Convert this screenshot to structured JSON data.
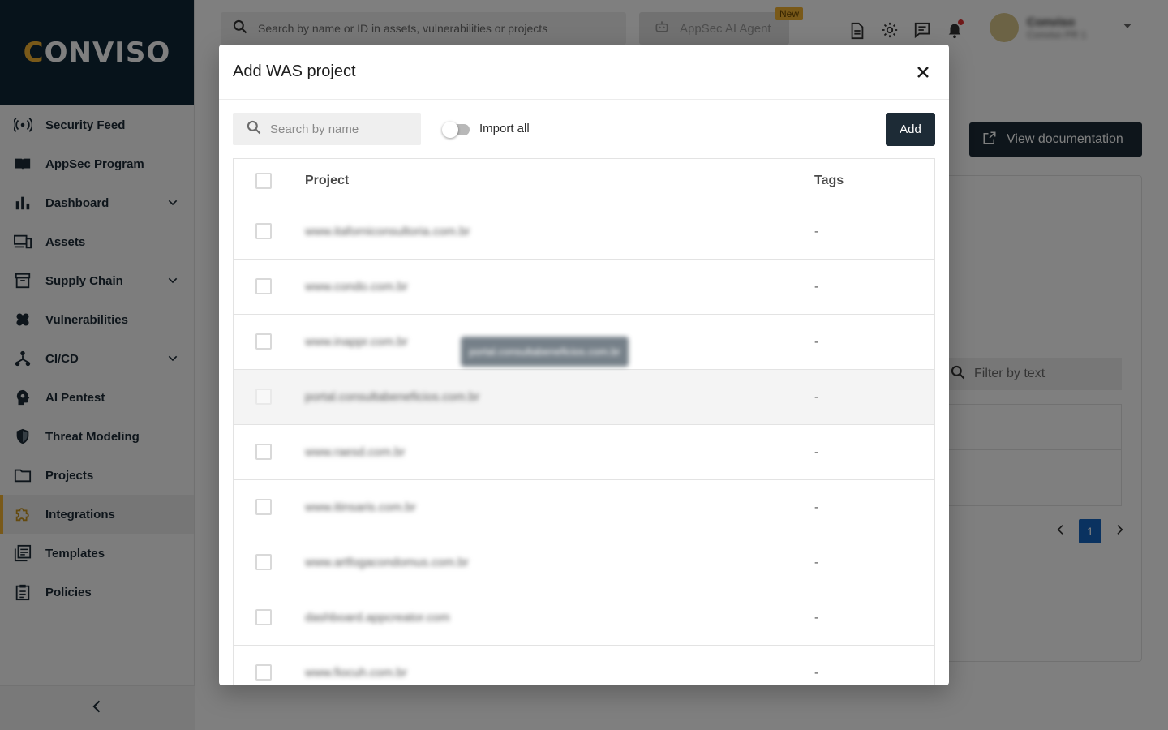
{
  "brand": {
    "logo_text": "CONVISO",
    "accent_color": "#f2b233",
    "sidebar_header_color": "#0f2637"
  },
  "sidebar": {
    "items": [
      {
        "label": "Security Feed",
        "icon": "broadcast-icon"
      },
      {
        "label": "AppSec Program",
        "icon": "book-icon"
      },
      {
        "label": "Dashboard",
        "icon": "bar-chart-icon",
        "expandable": true
      },
      {
        "label": "Assets",
        "icon": "devices-icon"
      },
      {
        "label": "Supply Chain",
        "icon": "archive-box-icon",
        "expandable": true
      },
      {
        "label": "Vulnerabilities",
        "icon": "bandage-icon"
      },
      {
        "label": "CI/CD",
        "icon": "pipeline-icon",
        "expandable": true
      },
      {
        "label": "AI Pentest",
        "icon": "ai-head-icon"
      },
      {
        "label": "Threat Modeling",
        "icon": "shield-icon"
      },
      {
        "label": "Projects",
        "icon": "folder-icon"
      },
      {
        "label": "Integrations",
        "icon": "puzzle-icon",
        "active": true
      },
      {
        "label": "Templates",
        "icon": "template-icon"
      },
      {
        "label": "Policies",
        "icon": "clipboard-icon"
      }
    ]
  },
  "topbar": {
    "search_placeholder": "Search by name or ID in assets, vulnerabilities or projects",
    "ai_agent_label": "AppSec AI Agent",
    "new_badge": "New",
    "user_name": "Conviso",
    "user_org": "Conviso PR 1"
  },
  "background": {
    "doc_button": "View documentation",
    "filter_placeholder": "Filter by text",
    "current_page": "1"
  },
  "modal": {
    "title": "Add WAS project",
    "search_placeholder": "Search by name",
    "import_all_label": "Import all",
    "import_all_enabled": false,
    "add_button": "Add",
    "columns": {
      "project": "Project",
      "tags": "Tags"
    },
    "rows": [
      {
        "project": "www.itaforniconsultoria.com.br",
        "tags": "-"
      },
      {
        "project": "www.condo.com.br",
        "tags": "-"
      },
      {
        "project": "www.inappr.com.br",
        "tags": "-"
      },
      {
        "project": "portal.consultabeneficios.com.br",
        "tags": "-"
      },
      {
        "project": "www.raesd.com.br",
        "tags": "-"
      },
      {
        "project": "www.itinsaris.com.br",
        "tags": "-"
      },
      {
        "project": "www.artfogacondomus.com.br",
        "tags": "-"
      },
      {
        "project": "dashboard.appcreator.com",
        "tags": "-"
      },
      {
        "project": "www.fiocuh.com.br",
        "tags": "-"
      }
    ],
    "tooltip": "portal.consultabeneficios.com.br"
  }
}
